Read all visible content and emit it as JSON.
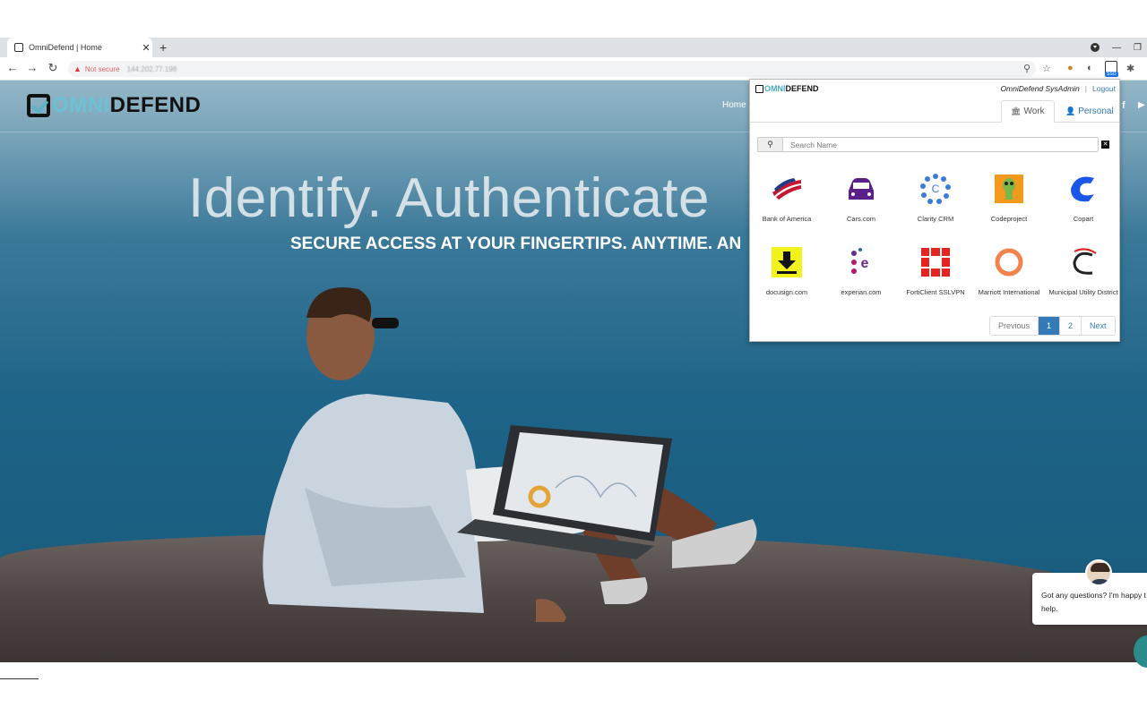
{
  "browser": {
    "tab_title": "OmniDefend | Home",
    "close_glyph": "✕",
    "new_tab_glyph": "+",
    "not_secure": "Not secure",
    "url": "144.202.77.198",
    "sso_badge": "SSO"
  },
  "site": {
    "logo_omni": "OMNI",
    "logo_defend": "DEFEND",
    "nav_home": "Home",
    "headline": "Identify. Authenticate",
    "subhead": "SECURE ACCESS AT YOUR FINGERTIPS. ANYTIME. AN"
  },
  "popup": {
    "logo_omni": "OMNI",
    "logo_defend": "DEFEND",
    "username": "OmniDefend SysAdmin",
    "separator": "|",
    "logout": "Logout",
    "tab_work": "Work",
    "tab_personal": "Personal",
    "search_placeholder": "Search Name",
    "apps": [
      {
        "label": "Bank of America",
        "icon": "bank-of-america-flag-icon"
      },
      {
        "label": "Cars.com",
        "icon": "car-icon"
      },
      {
        "label": "Clarity CRM",
        "icon": "clarity-crm-dots-icon"
      },
      {
        "label": "Codeproject",
        "icon": "codeproject-icon"
      },
      {
        "label": "Copart",
        "icon": "copart-c-icon"
      },
      {
        "label": "docusign.com",
        "icon": "docusign-download-icon"
      },
      {
        "label": "experian.com",
        "icon": "experian-e-icon"
      },
      {
        "label": "FortiClient SSLVPN",
        "icon": "forticlient-icon"
      },
      {
        "label": "Marriott International",
        "icon": "marriott-ring-icon"
      },
      {
        "label": "Municipal Utility District",
        "icon": "municipal-utility-c-icon"
      }
    ],
    "pagination": {
      "previous": "Previous",
      "page1": "1",
      "page2": "2",
      "next": "Next"
    }
  },
  "chat": {
    "message": "Got any questions? I'm happy t help."
  }
}
